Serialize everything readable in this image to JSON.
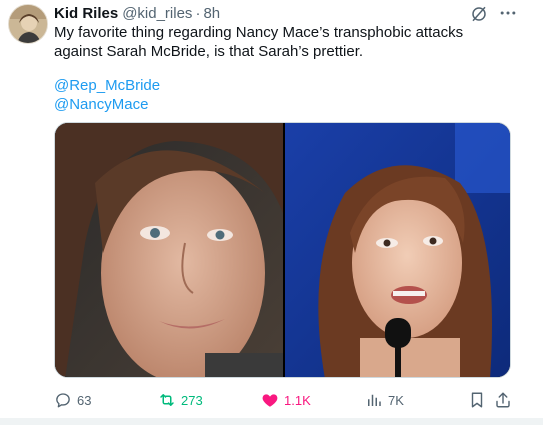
{
  "author": {
    "name": "Kid Riles",
    "handle": "@kid_riles",
    "separator": "·",
    "time": "8h"
  },
  "tweet": {
    "text": "My favorite thing regarding Nancy Mace’s transphobic attacks against Sarah McBride, is that Sarah’s prettier.",
    "mentions": [
      "@Rep_McBride",
      "@NancyMace"
    ]
  },
  "media": {
    "photos": [
      "portrait-left",
      "portrait-right"
    ]
  },
  "actions": {
    "replies": "63",
    "retweets": "273",
    "likes": "1.1K",
    "views": "7K"
  },
  "icons": {
    "grok": "grok-icon",
    "more": "more-icon",
    "reply": "reply-icon",
    "retweet": "retweet-icon",
    "like": "heart-icon",
    "views": "views-icon",
    "bookmark": "bookmark-icon",
    "share": "share-icon"
  },
  "colors": {
    "link": "#1d9bf0",
    "retweet": "#00ba7c",
    "like": "#f91880",
    "muted": "#536471"
  }
}
